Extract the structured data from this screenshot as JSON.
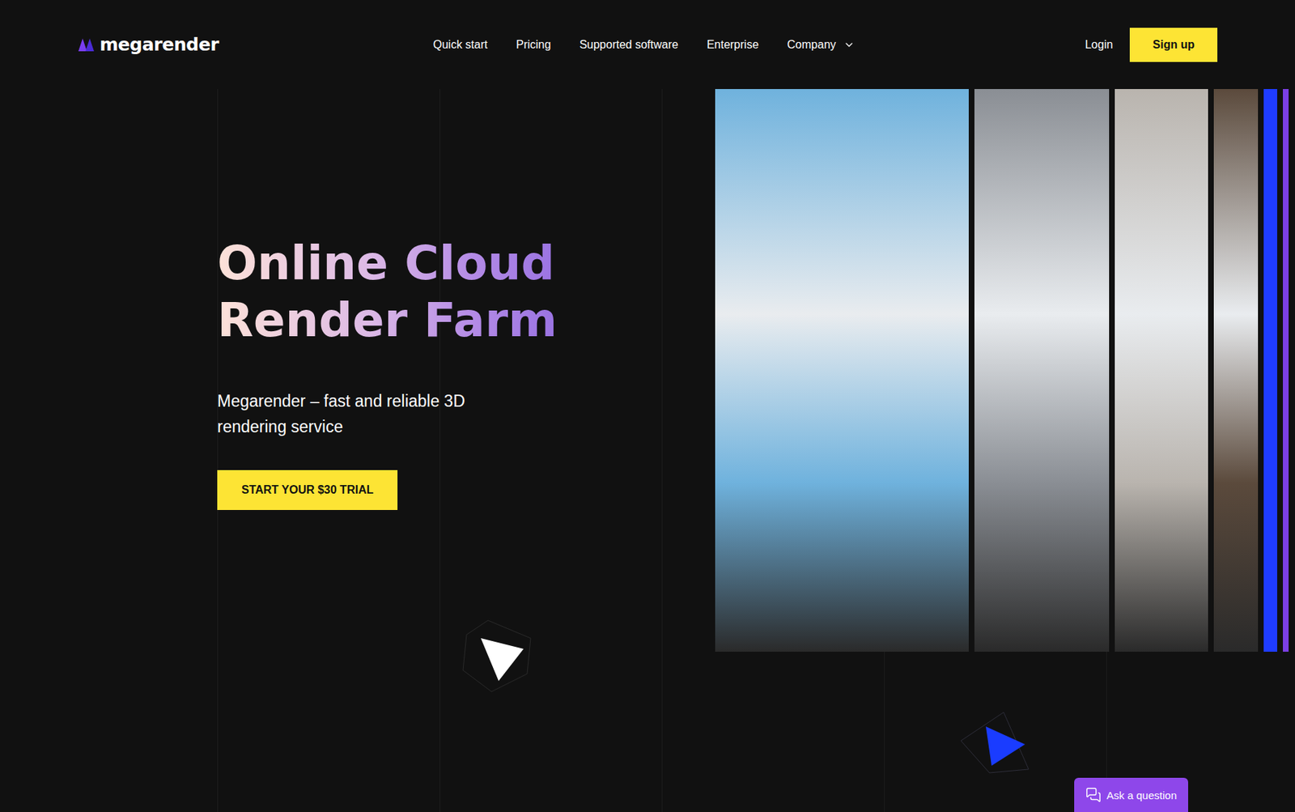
{
  "logo": {
    "text": "megarender"
  },
  "nav": {
    "items": [
      {
        "label": "Quick start",
        "has_dropdown": false
      },
      {
        "label": "Pricing",
        "has_dropdown": false
      },
      {
        "label": "Supported software",
        "has_dropdown": false
      },
      {
        "label": "Enterprise",
        "has_dropdown": false
      },
      {
        "label": "Company",
        "has_dropdown": true
      }
    ]
  },
  "auth": {
    "login": "Login",
    "signup": "Sign up"
  },
  "hero": {
    "title_lines": [
      "Online Cloud",
      "Render Farm"
    ],
    "subtitle": "Megarender – fast and reliable 3D rendering service",
    "cta": "START YOUR $30 TRIAL"
  },
  "gallery": [
    {
      "color": "#6fb2dd"
    },
    {
      "color": "#8a8e94"
    },
    {
      "color": "#b9b4ae"
    },
    {
      "color": "#5b4a3c"
    },
    {
      "color": "#1f3cff"
    },
    {
      "color": "#7b3fe4"
    }
  ],
  "chat": {
    "label": "Ask a question"
  }
}
